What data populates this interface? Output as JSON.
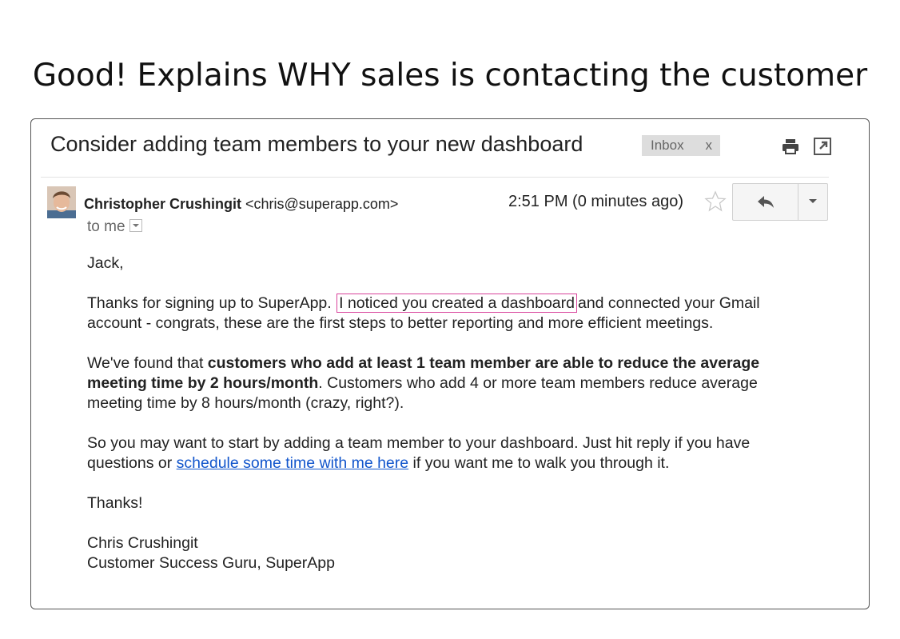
{
  "slide": {
    "title": "Good! Explains WHY sales is contacting the customer"
  },
  "email": {
    "subject": "Consider adding team members to your new dashboard",
    "label": "Inbox",
    "label_remove": "x",
    "sender_name": "Christopher Crushingit",
    "sender_email": "<chris@superapp.com>",
    "recipient": "to me",
    "timestamp": "2:51 PM (0 minutes ago)",
    "icons": {
      "print": "print-icon",
      "new_window": "new-window-icon",
      "star": "star-icon",
      "reply": "reply-icon",
      "more": "chevron-down-icon"
    },
    "body": {
      "greeting": "Jack,",
      "p1_start": "Thanks for signing up to SuperApp.",
      "p1_highlight": "I noticed you created a dashboard",
      "p1_end": "and connected your Gmail account - congrats, these are the first steps to better reporting and more efficient meetings.",
      "p2_start": "We've found that ",
      "p2_bold": "customers who add at least 1 team member are able to reduce the average meeting time by 2 hours/month",
      "p2_end": ". Customers who add 4 or more team members reduce average meeting time by 8 hours/month (crazy, right?).",
      "p3_start": "So you may want to start by adding a team member to your dashboard. Just hit reply if you have questions or ",
      "p3_link": "schedule some time with me here",
      "p3_end": " if you want me to walk you through it.",
      "closing": "Thanks!",
      "signature_name": "Chris Crushingit",
      "signature_title": "Customer Success Guru, SuperApp"
    },
    "colors": {
      "highlight_border": "#d9439b",
      "link": "#1155cc",
      "label_bg": "#dddddd"
    }
  }
}
